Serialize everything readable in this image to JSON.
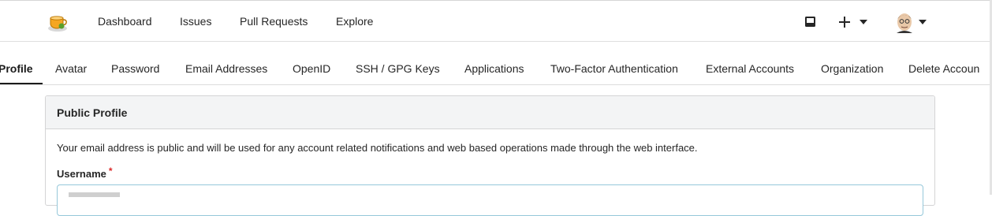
{
  "topbar": {
    "nav": [
      "Dashboard",
      "Issues",
      "Pull Requests",
      "Explore"
    ],
    "icons": {
      "logo": "tea-cup-logo",
      "inbox": "inbox-icon",
      "create": "plus-icon",
      "user": "avatar"
    }
  },
  "settings_nav": {
    "tabs": [
      "Profile",
      "Avatar",
      "Password",
      "Email Addresses",
      "OpenID",
      "SSH / GPG Keys",
      "Applications",
      "Two-Factor Authentication",
      "External Accounts",
      "Organization",
      "Delete Accoun"
    ],
    "active_index": 0
  },
  "profile": {
    "title": "Public Profile",
    "help": "Your email address is public and will be used for any account related notifications and web based operations made through the web interface.",
    "username_label": "Username",
    "required_mark": "*"
  },
  "colors": {
    "accent": "#96c8da",
    "required": "#db2828",
    "header_bg": "#f3f4f5"
  }
}
